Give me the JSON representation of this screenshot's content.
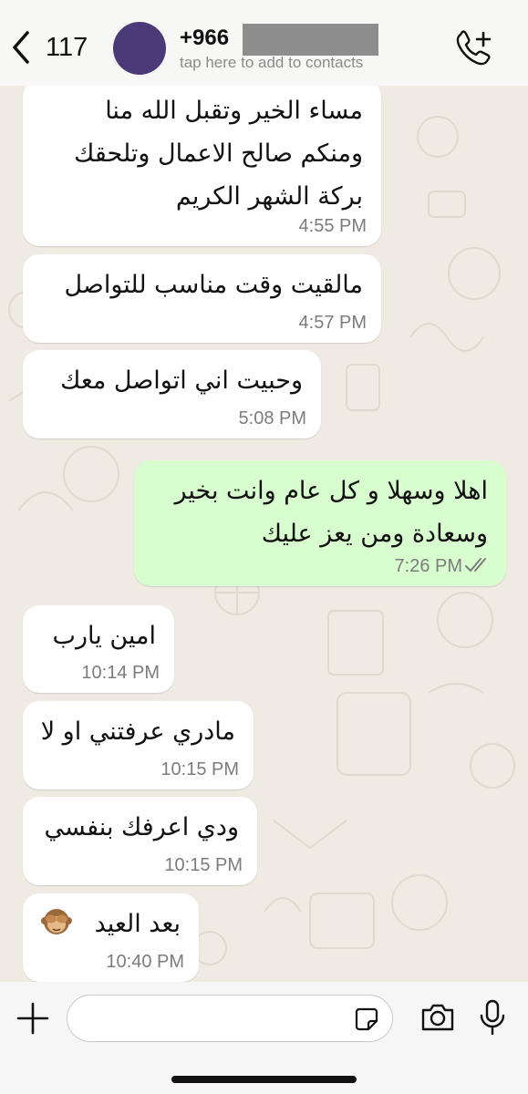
{
  "header": {
    "back_count": "117",
    "contact_name": "+966",
    "contact_subtitle": "tap here to add to contacts",
    "avatar_color": "#4b3a78"
  },
  "messages": [
    {
      "direction": "incoming",
      "lines": [
        "مساء الخير وتقبل الله منا",
        "ومنكم صالح الاعمال وتلحقك",
        "بركة الشهر الكريم"
      ],
      "time": "4:55 PM"
    },
    {
      "direction": "incoming",
      "lines": [
        "مالقيت وقت مناسب للتواصل"
      ],
      "time": "4:57 PM"
    },
    {
      "direction": "incoming",
      "lines": [
        "وحبيت اني اتواصل معك"
      ],
      "time": "5:08 PM"
    },
    {
      "direction": "outgoing",
      "lines": [
        "اهلا وسهلا و كل عام وانت بخير",
        "وسعادة ومن يعز عليك"
      ],
      "time": "7:26 PM",
      "status": "read"
    },
    {
      "direction": "incoming",
      "lines": [
        "امين يارب"
      ],
      "time": "10:14 PM"
    },
    {
      "direction": "incoming",
      "lines": [
        "مادري عرفتني او لا"
      ],
      "time": "10:15 PM"
    },
    {
      "direction": "incoming",
      "lines": [
        "ودي اعرفك بنفسي"
      ],
      "time": "10:15 PM"
    },
    {
      "direction": "incoming",
      "lines": [
        "بعد العيد"
      ],
      "time": "10:40 PM",
      "emoji": "see-no-evil-monkey"
    }
  ],
  "input": {
    "placeholder": ""
  },
  "colors": {
    "incoming_bubble": "#ffffff",
    "outgoing_bubble": "#d8fdcf",
    "chat_background": "#efeae2",
    "read_ticks": "#7c7c7c"
  },
  "icons": [
    "chevron-left-icon",
    "phone-add-icon",
    "plus-icon",
    "sticker-icon",
    "camera-icon",
    "microphone-icon",
    "double-check-icon"
  ]
}
